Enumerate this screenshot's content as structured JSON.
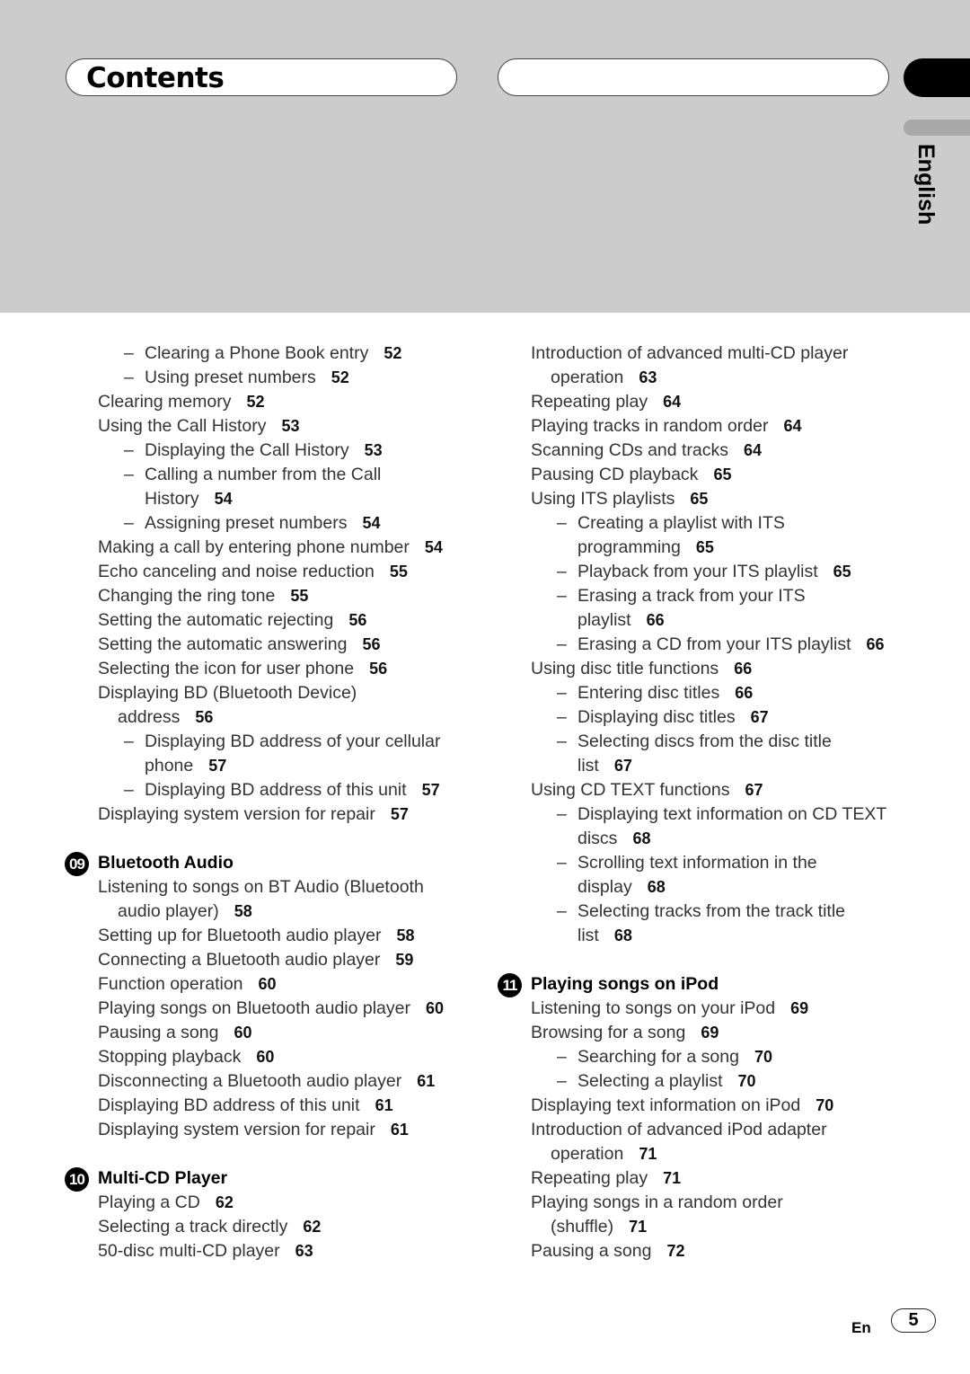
{
  "header": {
    "title": "Contents",
    "language_tab": "English"
  },
  "left_column": [
    {
      "type": "sub",
      "text": "Clearing a Phone Book entry",
      "page": "52"
    },
    {
      "type": "sub",
      "text": "Using preset numbers",
      "page": "52"
    },
    {
      "type": "item",
      "text": "Clearing memory",
      "page": "52"
    },
    {
      "type": "item",
      "text": "Using the Call History",
      "page": "53"
    },
    {
      "type": "sub",
      "text": "Displaying the Call History",
      "page": "53"
    },
    {
      "type": "sub",
      "text": "Calling a number from the Call"
    },
    {
      "type": "subcont",
      "text": "History",
      "page": "54"
    },
    {
      "type": "sub",
      "text": "Assigning preset numbers",
      "page": "54"
    },
    {
      "type": "item",
      "text": "Making a call by entering phone number",
      "page": "54"
    },
    {
      "type": "item",
      "text": "Echo canceling and noise reduction",
      "page": "55"
    },
    {
      "type": "item",
      "text": "Changing the ring tone",
      "page": "55"
    },
    {
      "type": "item",
      "text": "Setting the automatic rejecting",
      "page": "56"
    },
    {
      "type": "item",
      "text": "Setting the automatic answering",
      "page": "56"
    },
    {
      "type": "item",
      "text": "Selecting the icon for user phone",
      "page": "56"
    },
    {
      "type": "item",
      "text": "Displaying BD (Bluetooth Device)"
    },
    {
      "type": "cont",
      "text": "address",
      "page": "56"
    },
    {
      "type": "sub",
      "text": "Displaying BD address of your cellular"
    },
    {
      "type": "subcont",
      "text": "phone",
      "page": "57"
    },
    {
      "type": "sub",
      "text": "Displaying BD address of this unit",
      "page": "57"
    },
    {
      "type": "item",
      "text": "Displaying system version for repair",
      "page": "57"
    },
    {
      "type": "section",
      "num": "09",
      "text": "Bluetooth Audio"
    },
    {
      "type": "item",
      "text": "Listening to songs on BT Audio (Bluetooth"
    },
    {
      "type": "cont",
      "text": "audio player)",
      "page": "58"
    },
    {
      "type": "item",
      "text": "Setting up for Bluetooth audio player",
      "page": "58"
    },
    {
      "type": "item",
      "text": "Connecting a Bluetooth audio player",
      "page": "59"
    },
    {
      "type": "item",
      "text": "Function operation",
      "page": "60"
    },
    {
      "type": "item",
      "text": "Playing songs on Bluetooth audio player",
      "page": "60"
    },
    {
      "type": "item",
      "text": "Pausing a song",
      "page": "60"
    },
    {
      "type": "item",
      "text": "Stopping playback",
      "page": "60"
    },
    {
      "type": "item",
      "text": "Disconnecting a Bluetooth audio player",
      "page": "61"
    },
    {
      "type": "item",
      "text": "Displaying BD address of this unit",
      "page": "61"
    },
    {
      "type": "item",
      "text": "Displaying system version for repair",
      "page": "61"
    },
    {
      "type": "section",
      "num": "10",
      "text": "Multi-CD Player"
    },
    {
      "type": "item",
      "text": "Playing a CD",
      "page": "62"
    },
    {
      "type": "item",
      "text": "Selecting a track directly",
      "page": "62"
    },
    {
      "type": "item",
      "text": "50-disc multi-CD player",
      "page": "63"
    }
  ],
  "right_column": [
    {
      "type": "item",
      "text": "Introduction of advanced multi-CD player"
    },
    {
      "type": "cont",
      "text": "operation",
      "page": "63"
    },
    {
      "type": "item",
      "text": "Repeating play",
      "page": "64"
    },
    {
      "type": "item",
      "text": "Playing tracks in random order",
      "page": "64"
    },
    {
      "type": "item",
      "text": "Scanning CDs and tracks",
      "page": "64"
    },
    {
      "type": "item",
      "text": "Pausing CD playback",
      "page": "65"
    },
    {
      "type": "item",
      "text": "Using ITS playlists",
      "page": "65"
    },
    {
      "type": "sub",
      "text": "Creating a playlist with ITS"
    },
    {
      "type": "subcont",
      "text": "programming",
      "page": "65"
    },
    {
      "type": "sub",
      "text": "Playback from your ITS playlist",
      "page": "65"
    },
    {
      "type": "sub",
      "text": "Erasing a track from your ITS"
    },
    {
      "type": "subcont",
      "text": "playlist",
      "page": "66"
    },
    {
      "type": "sub",
      "text": "Erasing a CD from your ITS playlist",
      "page": "66"
    },
    {
      "type": "item",
      "text": "Using disc title functions",
      "page": "66"
    },
    {
      "type": "sub",
      "text": "Entering disc titles",
      "page": "66"
    },
    {
      "type": "sub",
      "text": "Displaying disc titles",
      "page": "67"
    },
    {
      "type": "sub",
      "text": "Selecting discs from the disc title"
    },
    {
      "type": "subcont",
      "text": "list",
      "page": "67"
    },
    {
      "type": "item",
      "text": "Using CD TEXT functions",
      "page": "67"
    },
    {
      "type": "sub",
      "text": "Displaying text information on CD TEXT"
    },
    {
      "type": "subcont",
      "text": "discs",
      "page": "68"
    },
    {
      "type": "sub",
      "text": "Scrolling text information in the"
    },
    {
      "type": "subcont",
      "text": "display",
      "page": "68"
    },
    {
      "type": "sub",
      "text": "Selecting tracks from the track title"
    },
    {
      "type": "subcont",
      "text": "list",
      "page": "68"
    },
    {
      "type": "section",
      "num": "11",
      "text": "Playing songs on iPod"
    },
    {
      "type": "item",
      "text": "Listening to songs on your iPod",
      "page": "69"
    },
    {
      "type": "item",
      "text": "Browsing for a song",
      "page": "69"
    },
    {
      "type": "sub",
      "text": "Searching for a song",
      "page": "70"
    },
    {
      "type": "sub",
      "text": "Selecting a playlist",
      "page": "70"
    },
    {
      "type": "item",
      "text": "Displaying text information on iPod",
      "page": "70"
    },
    {
      "type": "item",
      "text": "Introduction of advanced iPod adapter"
    },
    {
      "type": "cont",
      "text": "operation",
      "page": "71"
    },
    {
      "type": "item",
      "text": "Repeating play",
      "page": "71"
    },
    {
      "type": "item",
      "text": "Playing songs in a random order"
    },
    {
      "type": "cont",
      "text": "(shuffle)",
      "page": "71"
    },
    {
      "type": "item",
      "text": "Pausing a song",
      "page": "72"
    }
  ],
  "footer": {
    "lang_code": "En",
    "page_number": "5"
  },
  "dash": "–"
}
